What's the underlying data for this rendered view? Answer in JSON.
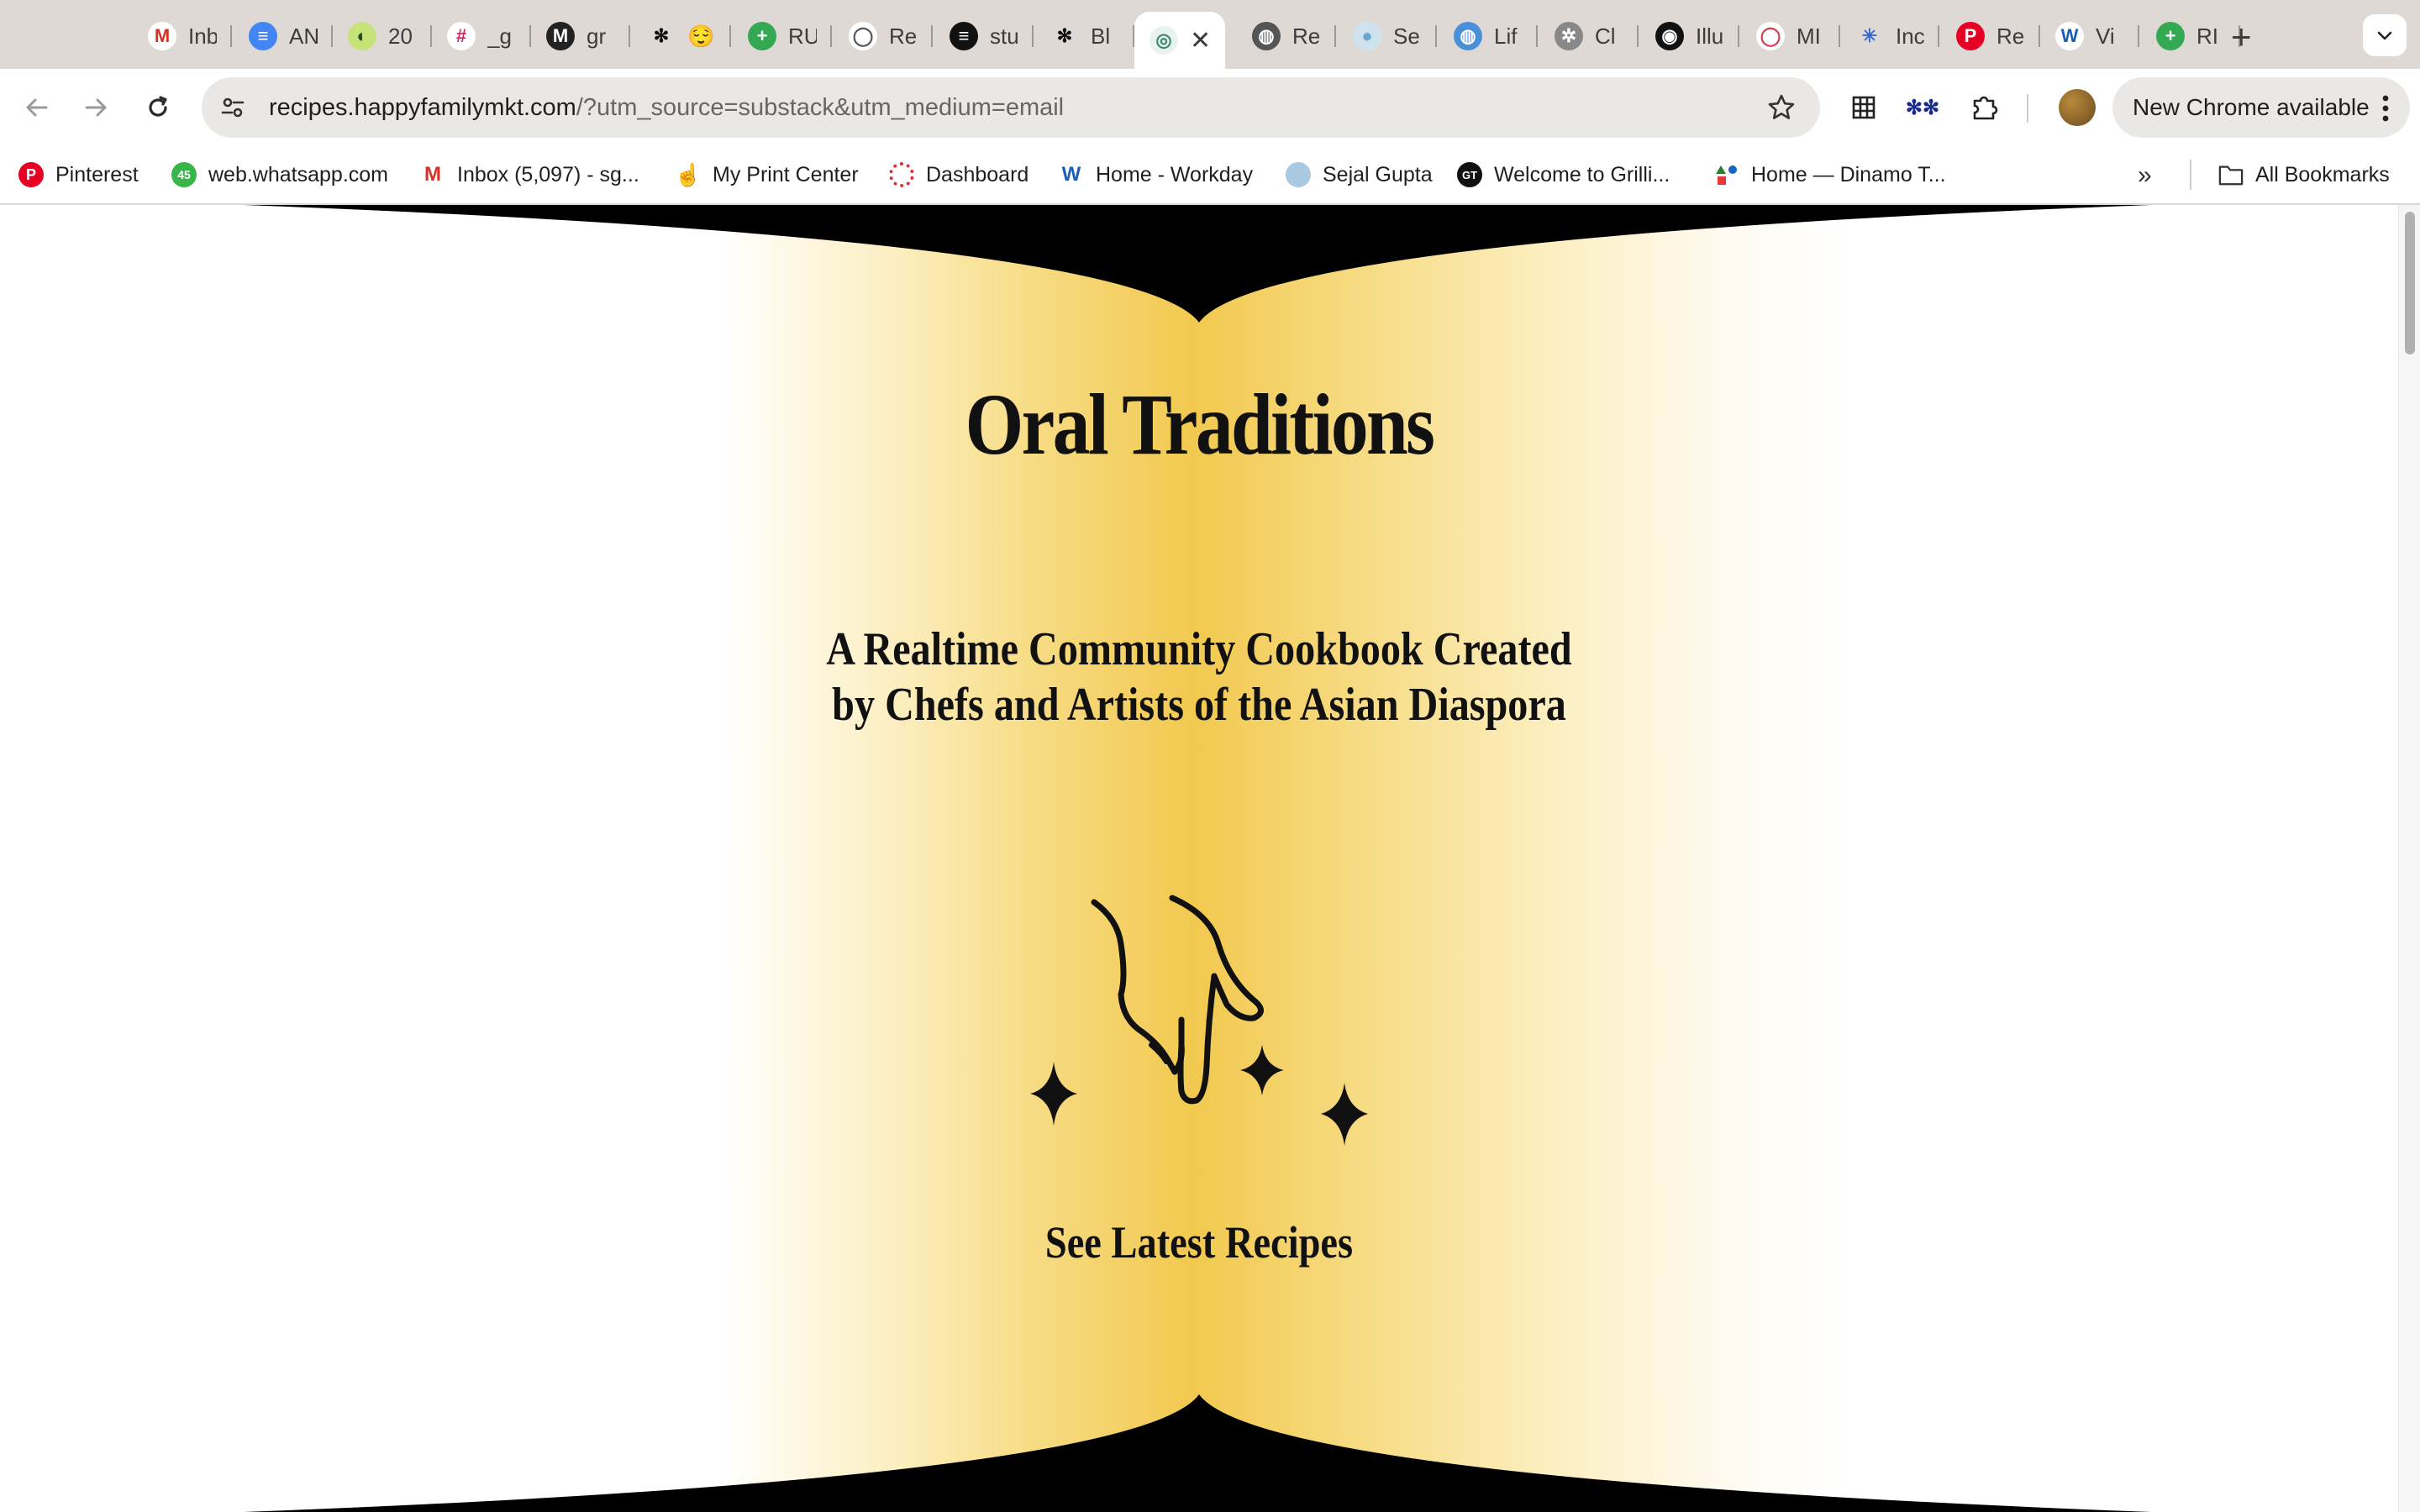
{
  "browser": {
    "tabs": [
      {
        "title": "Inb",
        "icon": "gmail-icon",
        "active": false
      },
      {
        "title": "AN",
        "icon": "google-docs-icon",
        "active": false
      },
      {
        "title": "20",
        "icon": "green-circle-icon",
        "active": false
      },
      {
        "title": "_g",
        "icon": "slack-icon",
        "active": false
      },
      {
        "title": "gr",
        "icon": "m-logo-icon",
        "active": false
      },
      {
        "title": "😌",
        "icon": "asterisk-pair-icon",
        "active": false
      },
      {
        "title": "RU",
        "icon": "green-plus-icon",
        "active": false
      },
      {
        "title": "Re",
        "icon": "circle-logo-icon",
        "active": false
      },
      {
        "title": "stu",
        "icon": "black-square-icon",
        "active": false
      },
      {
        "title": "Bl",
        "icon": "asterisk-pair-icon",
        "active": false
      },
      {
        "title": "",
        "icon": "spiral-icon",
        "active": true
      },
      {
        "title": "Re",
        "icon": "globe-icon",
        "active": false
      },
      {
        "title": "Se",
        "icon": "blue-dot-icon",
        "active": false
      },
      {
        "title": "Lif",
        "icon": "blue-globe-icon",
        "active": false
      },
      {
        "title": "Cl",
        "icon": "gear-logo-icon",
        "active": false
      },
      {
        "title": "Illu",
        "icon": "dark-circle-icon",
        "active": false
      },
      {
        "title": "MI",
        "icon": "ring-icon",
        "active": false
      },
      {
        "title": "Inc",
        "icon": "sparkle-icon",
        "active": false
      },
      {
        "title": "Re",
        "icon": "pinterest-icon",
        "active": false
      },
      {
        "title": "Vi",
        "icon": "workday-icon",
        "active": false
      },
      {
        "title": "RI",
        "icon": "green-plus-icon",
        "active": false
      }
    ],
    "new_tab_label": "+",
    "address": {
      "host": "recipes.happyfamilymkt.com",
      "path": "/?utm_source=substack&utm_medium=email"
    },
    "update_button_label": "New Chrome available",
    "bookmarks": [
      {
        "label": "Pinterest",
        "icon": "pinterest-icon"
      },
      {
        "label": "web.whatsapp.com",
        "icon": "whatsapp-icon",
        "badge": "45"
      },
      {
        "label": "Inbox (5,097) - sg...",
        "icon": "gmail-icon"
      },
      {
        "label": "My Print Center",
        "icon": "hand-icon"
      },
      {
        "label": "Dashboard",
        "icon": "red-wheel-icon"
      },
      {
        "label": "Home - Workday",
        "icon": "workday-icon"
      },
      {
        "label": "Sejal Gupta",
        "icon": "blue-dot-icon"
      },
      {
        "label": "Welcome to Grilli...",
        "icon": "gt-logo-icon",
        "icon_text": "GT"
      },
      {
        "label": "Home — Dinamo T...",
        "icon": "shapes-icon"
      }
    ],
    "all_bookmarks_label": "All Bookmarks",
    "colors": {
      "tabstrip": "#dfd9d6",
      "omnibox": "#ebe7e5"
    }
  },
  "page": {
    "title": "Oral Traditions",
    "subtitle_line1": "A Realtime Community Cookbook Created",
    "subtitle_line2": "by Chefs and Artists of the Asian Diaspora",
    "cta_label": "See Latest Recipes",
    "illustration": "pointing-hand-with-sparkles-icon",
    "colors": {
      "gold": "#f2c94f",
      "ink": "#111111",
      "arch": "#000000"
    }
  }
}
